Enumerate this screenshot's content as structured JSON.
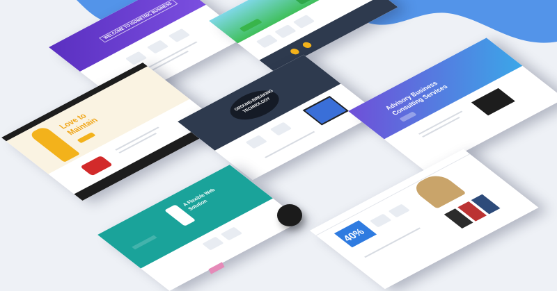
{
  "colors": {
    "background": "#eef1f6",
    "blob": "#4a8ee8",
    "purple": "#6a3fd2",
    "yellow": "#f3b21b",
    "dark_navy": "#2e3a4e",
    "teal": "#1aa39a",
    "gradient_start": "#6f4fd8",
    "gradient_end": "#3ba7e8",
    "sale_blue": "#2f7be0"
  },
  "cards": {
    "purple_welcome": {
      "headline": "WELCOME TO ISOMETRIC BUSINESS"
    },
    "green_hero": {},
    "maintain": {
      "headline_line1": "Love to",
      "headline_line2": "Maintain"
    },
    "dark_tech": {
      "headline_line1": "GROUND-BREAKING",
      "headline_line2": "TECHNOLOGY"
    },
    "advisory": {
      "headline_line1": "Advisory Business",
      "headline_line2": "Consulting Services"
    },
    "teal_web": {
      "headline_line1": "A Flexible Web",
      "headline_line2": "Solution"
    },
    "sale": {
      "discount": "40%"
    }
  }
}
